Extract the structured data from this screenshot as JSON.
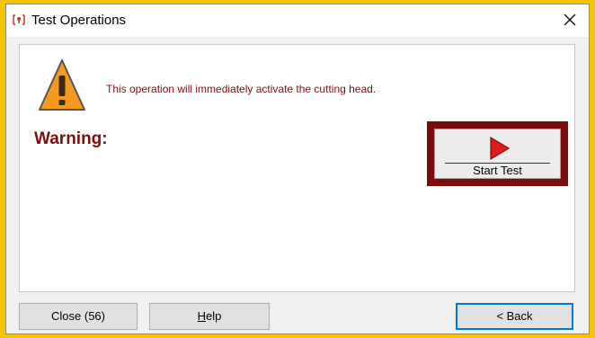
{
  "window": {
    "title": "Test Operations"
  },
  "content": {
    "message": "This operation will immediately activate the cutting head.",
    "warning_heading": "Warning:",
    "start_test_label": "Start Test"
  },
  "buttons": {
    "close_label": "Close (56)",
    "help_label": "Help",
    "back_label": "< Back"
  },
  "colors": {
    "accent_dark_red": "#7c0c0c",
    "warning_text": "#7a1010",
    "warning_icon_orange": "#f39a1f",
    "arrow_red": "#e01b1b",
    "focus_blue": "#0078d7",
    "outer_highlight": "#f5c400"
  },
  "icons": {
    "app": "app-icon",
    "close": "close-icon",
    "warning": "warning-triangle-icon",
    "start": "play-arrow-icon"
  }
}
